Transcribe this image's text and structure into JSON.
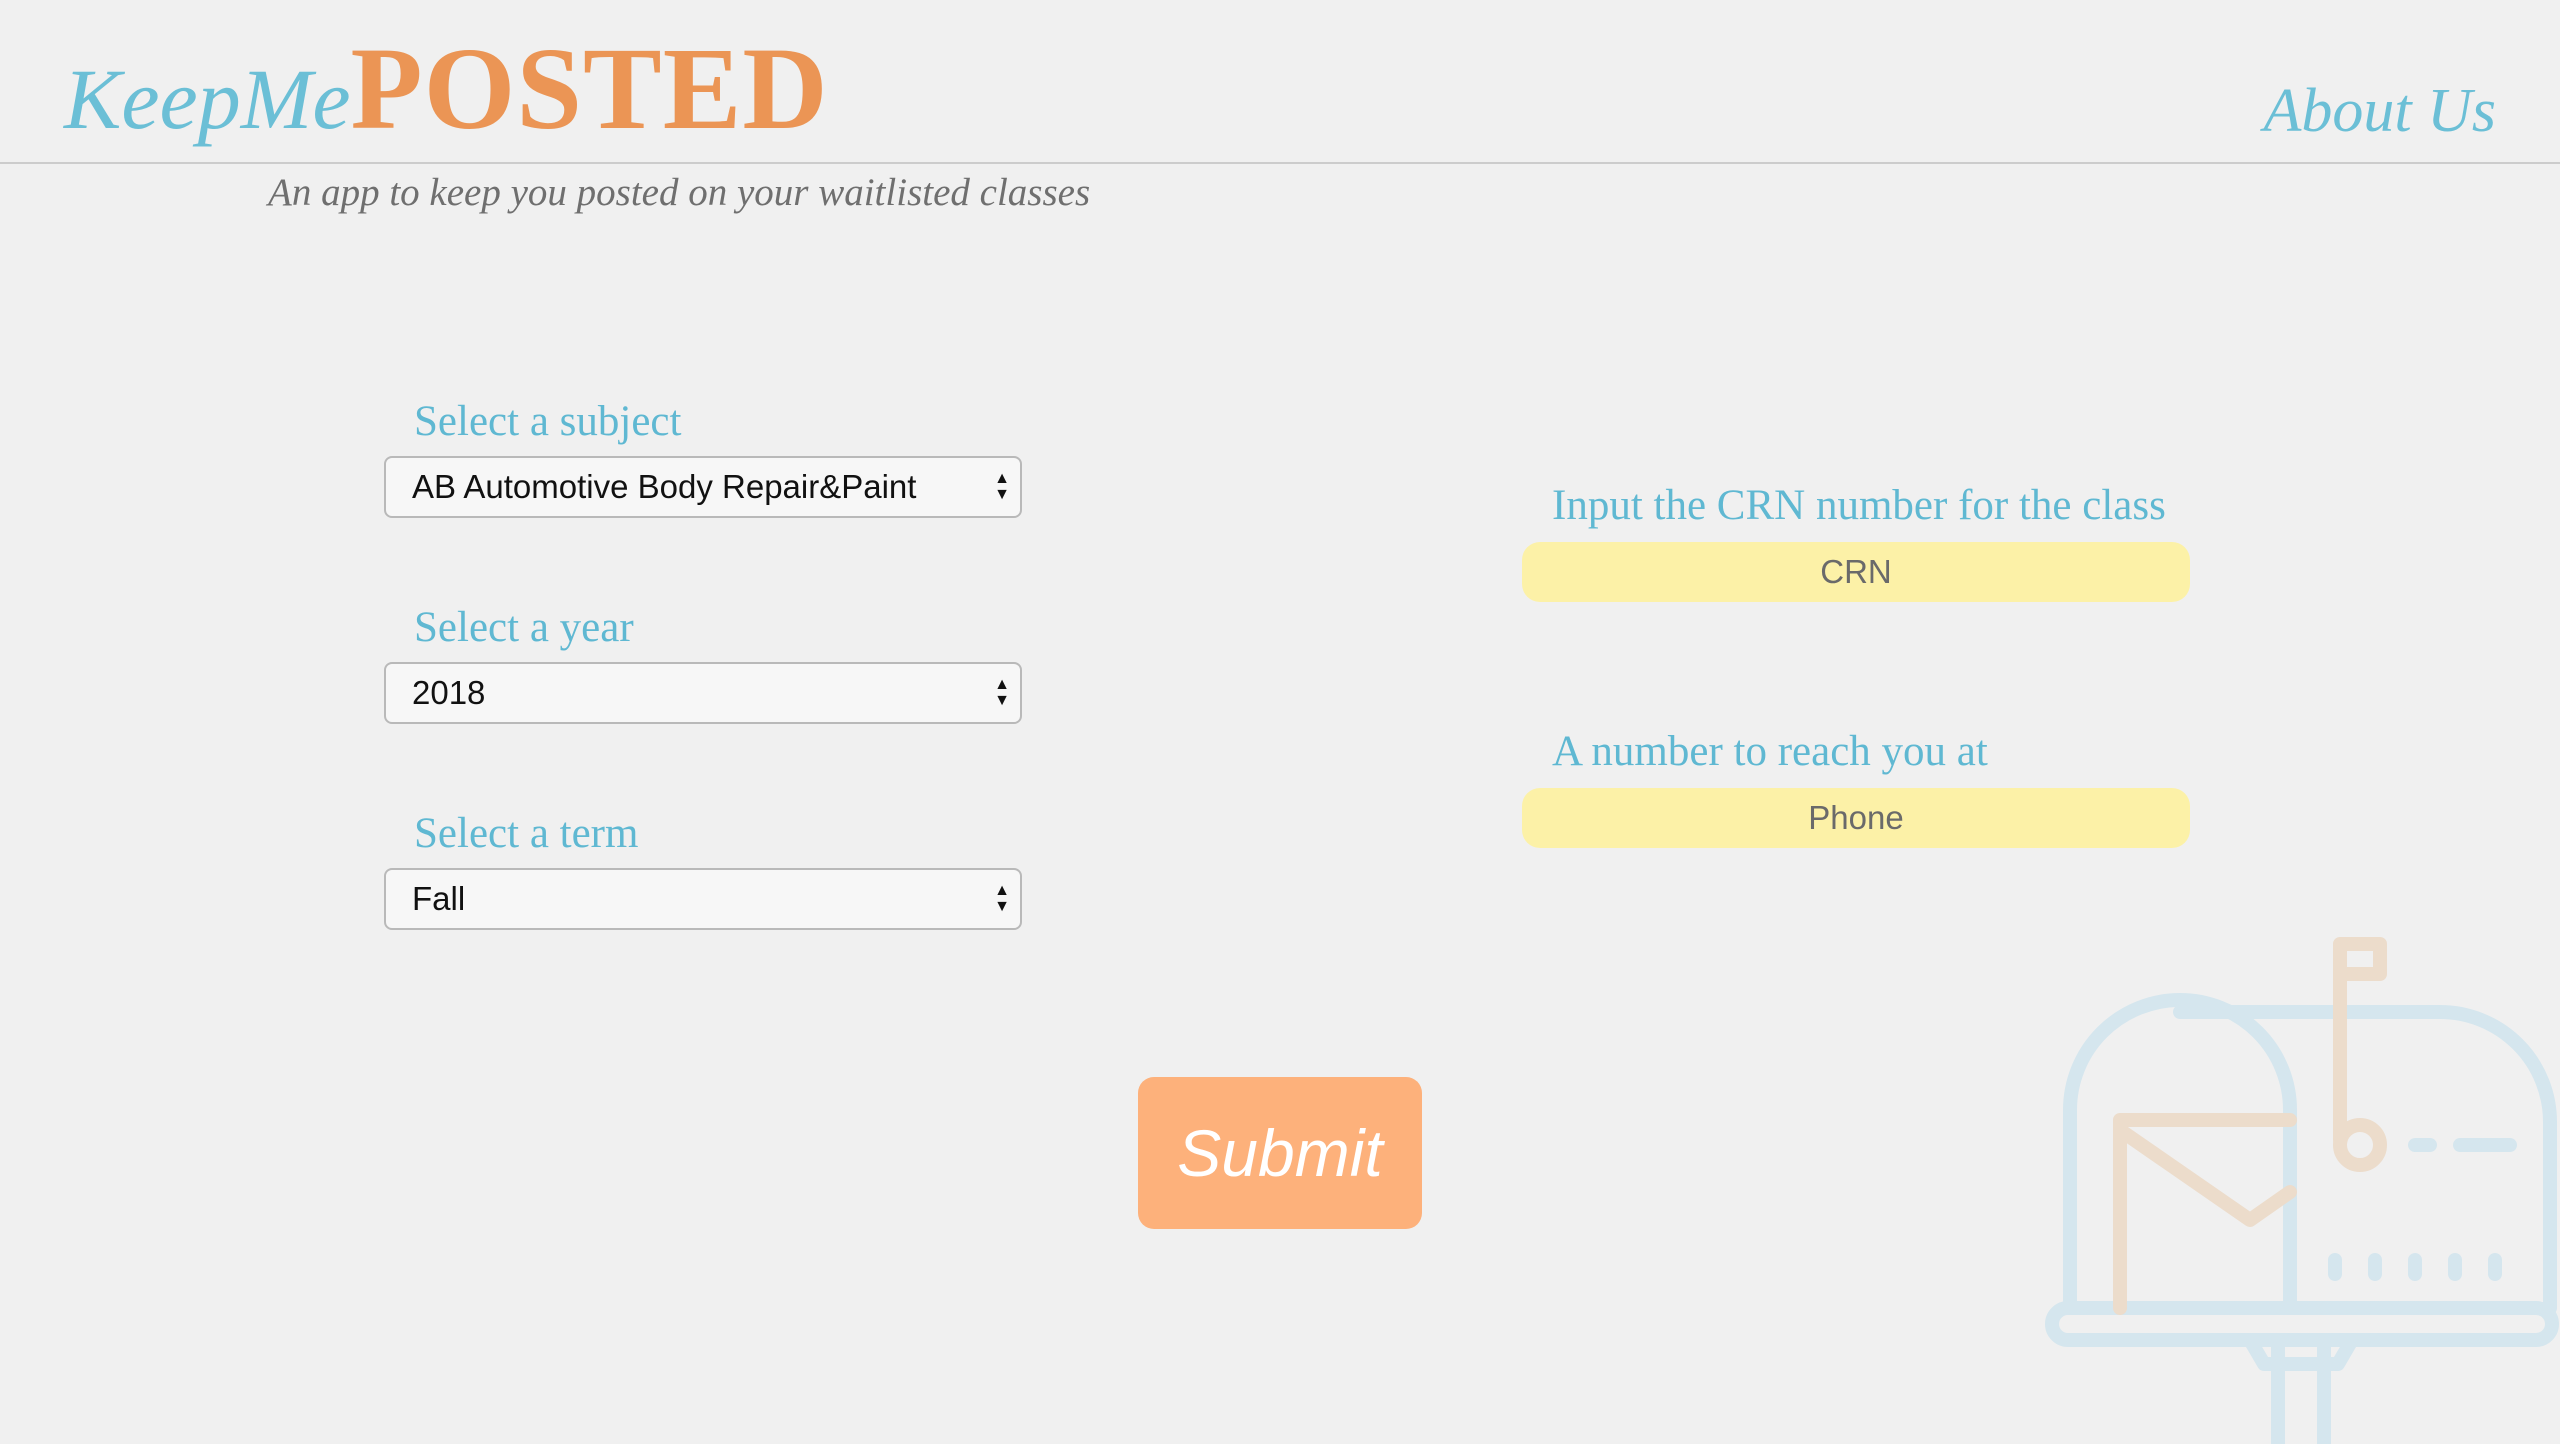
{
  "header": {
    "logo_keep": "KeepMe",
    "logo_posted": "POSTED",
    "about_link": "About Us",
    "tagline": "An app to keep you posted on your waitlisted classes"
  },
  "form": {
    "subject": {
      "label": "Select a subject",
      "value": "AB Automotive Body Repair&Paint"
    },
    "year": {
      "label": "Select a year",
      "value": "2018"
    },
    "term": {
      "label": "Select a term",
      "value": "Fall"
    },
    "crn": {
      "label": "Input the CRN number for the class",
      "placeholder": "CRN"
    },
    "phone": {
      "label": "A number to reach you at",
      "placeholder": "Phone"
    },
    "submit_label": "Submit"
  },
  "decor": {
    "mailbox_icon": "mailbox-icon"
  },
  "colors": {
    "accent_blue": "#6bbfd6",
    "accent_orange": "#eb9555",
    "button_orange": "#fdb17b",
    "input_yellow": "#fcf1a7",
    "background": "#f0f0f0"
  }
}
